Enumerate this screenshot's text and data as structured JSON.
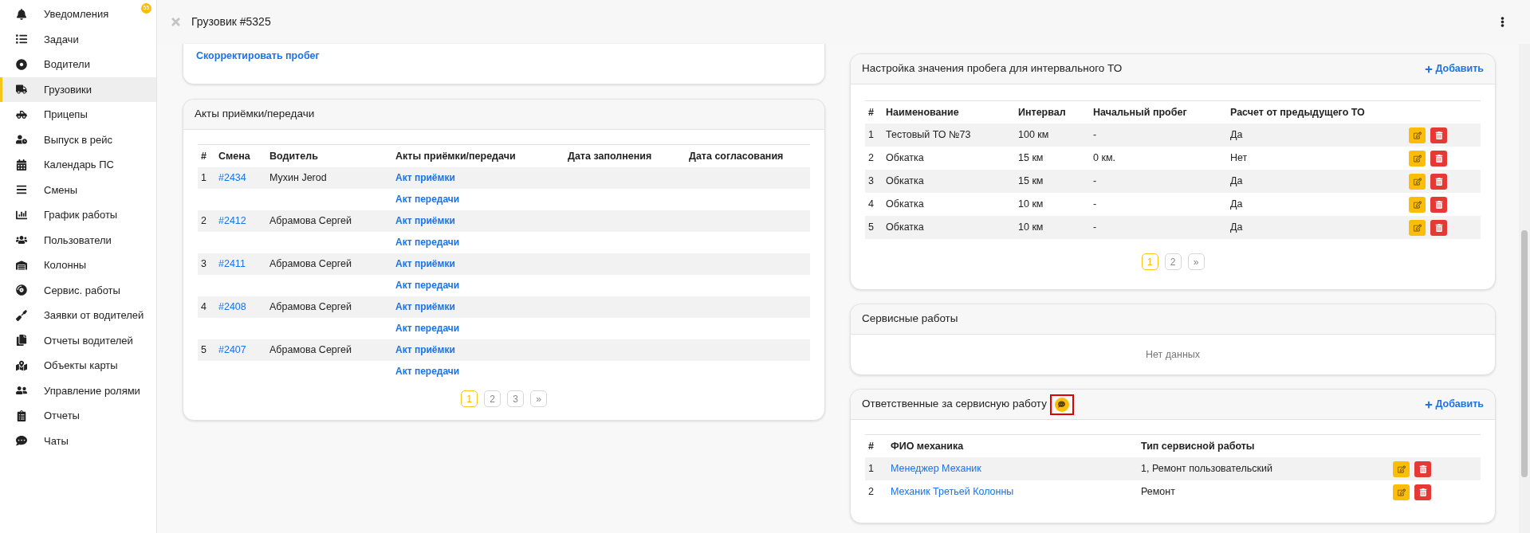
{
  "sidebar": {
    "items": [
      {
        "label": "Уведомления",
        "selected": false,
        "badge": "55"
      },
      {
        "label": "Задачи",
        "selected": false
      },
      {
        "label": "Водители",
        "selected": false
      },
      {
        "label": "Грузовики",
        "selected": true
      },
      {
        "label": "Прицепы",
        "selected": false
      },
      {
        "label": "Выпуск в рейс",
        "selected": false
      },
      {
        "label": "Календарь ПС",
        "selected": false
      },
      {
        "label": "Смены",
        "selected": false
      },
      {
        "label": "График работы",
        "selected": false
      },
      {
        "label": "Пользователи",
        "selected": false
      },
      {
        "label": "Колонны",
        "selected": false
      },
      {
        "label": "Сервис. работы",
        "selected": false
      },
      {
        "label": "Заявки от водителей",
        "selected": false
      },
      {
        "label": "Отчеты водителей",
        "selected": false
      },
      {
        "label": "Объекты карты",
        "selected": false
      },
      {
        "label": "Управление ролями",
        "selected": false
      },
      {
        "label": "Отчеты",
        "selected": false
      },
      {
        "label": "Чаты",
        "selected": false
      }
    ]
  },
  "header": {
    "title": "Грузовик #5325"
  },
  "mileage_card": {
    "link": "Скорректировать пробег"
  },
  "acts_card": {
    "title": "Акты приёмки/передачи",
    "columns": [
      "#",
      "Смена",
      "Водитель",
      "Акты приёмки/передачи",
      "Дата заполнения",
      "Дата согласования"
    ],
    "rows": [
      {
        "num": "1",
        "shift": "#2434",
        "driver": "Мухин Jerod",
        "acts": [
          "Акт приёмки",
          "Акт передачи"
        ]
      },
      {
        "num": "2",
        "shift": "#2412",
        "driver": "Абрамова Сергей",
        "acts": [
          "Акт приёмки",
          "Акт передачи"
        ]
      },
      {
        "num": "3",
        "shift": "#2411",
        "driver": "Абрамова Сергей",
        "acts": [
          "Акт приёмки",
          "Акт передачи"
        ]
      },
      {
        "num": "4",
        "shift": "#2408",
        "driver": "Абрамова Сергей",
        "acts": [
          "Акт приёмки",
          "Акт передачи"
        ]
      },
      {
        "num": "5",
        "shift": "#2407",
        "driver": "Абрамова Сергей",
        "acts": [
          "Акт приёмки",
          "Акт передачи"
        ]
      }
    ],
    "pagination": [
      {
        "label": "1",
        "selected": true
      },
      {
        "label": "2",
        "selected": false
      },
      {
        "label": "3",
        "selected": false
      },
      {
        "label": "»",
        "selected": false
      }
    ]
  },
  "interval_card": {
    "title": "Настройка значения пробега для интервального ТО",
    "add": "Добавить",
    "columns": [
      "#",
      "Наименование",
      "Интервал",
      "Начальный пробег",
      "Расчет от предыдущего ТО"
    ],
    "rows": [
      [
        "1",
        "Тестовый ТО №73",
        "100 км",
        "-",
        "Да"
      ],
      [
        "2",
        "Обкатка",
        "15 км",
        "0 км.",
        "Нет"
      ],
      [
        "3",
        "Обкатка",
        "15 км",
        "-",
        "Да"
      ],
      [
        "4",
        "Обкатка",
        "10 км",
        "-",
        "Да"
      ],
      [
        "5",
        "Обкатка",
        "10 км",
        "-",
        "Да"
      ]
    ],
    "pagination": [
      {
        "label": "1",
        "selected": true
      },
      {
        "label": "2",
        "selected": false
      },
      {
        "label": "»",
        "selected": false
      }
    ]
  },
  "service_card": {
    "title": "Сервисные работы",
    "empty": "Нет данных"
  },
  "responsible_card": {
    "title": "Ответственные за сервисную работу",
    "chat_highlighted": true,
    "add": "Добавить",
    "columns": [
      "#",
      "ФИО механика",
      "Тип сервисной работы"
    ],
    "rows": [
      [
        "1",
        "Менеджер Механик",
        "1, Ремонт пользовательский"
      ],
      [
        "2",
        "Механик Третьей Колонны",
        "Ремонт"
      ]
    ]
  }
}
